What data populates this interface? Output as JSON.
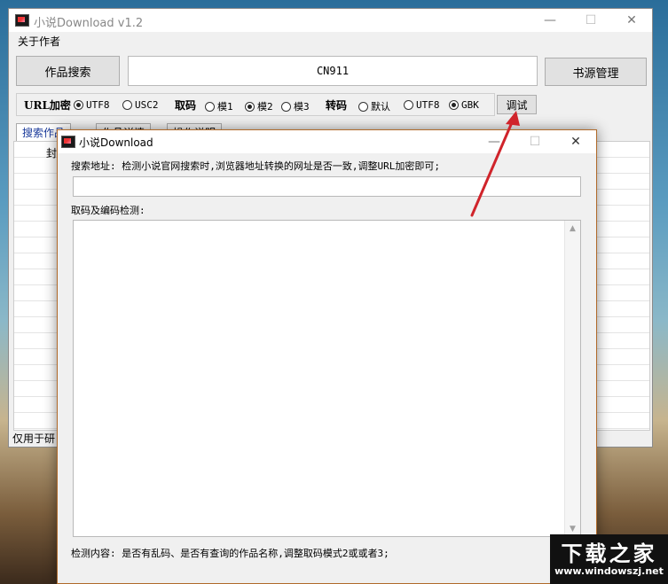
{
  "main_window": {
    "title": "小说Download v1.2",
    "controls": {
      "minimize": "—",
      "maximize": "☐",
      "close": "✕"
    },
    "menu": {
      "about": "关于作者"
    },
    "search_button": "作品搜索",
    "search_value": "CN911",
    "source_button": "书源管理",
    "url_encrypt_label": "URL加密",
    "url_encrypt_options": [
      {
        "label": "UTF8",
        "selected": true
      },
      {
        "label": "USC2",
        "selected": false
      }
    ],
    "fetch_label": "取码",
    "fetch_options": [
      {
        "label": "模1",
        "selected": false
      },
      {
        "label": "模2",
        "selected": true
      },
      {
        "label": "模3",
        "selected": false
      }
    ],
    "convert_label": "转码",
    "convert_options": [
      {
        "label": "默认",
        "selected": false
      },
      {
        "label": "UTF8",
        "selected": false
      },
      {
        "label": "GBK",
        "selected": true
      }
    ],
    "debug_button": "调试",
    "tabs": [
      "搜索作品",
      "作品详情",
      "操作说明"
    ],
    "partial_cell": "封",
    "status_text": "仅用于研"
  },
  "dialog": {
    "title": "小说Download",
    "controls": {
      "minimize": "—",
      "maximize": "☐",
      "close": "✕"
    },
    "search_url_label": "搜索地址: 检测小说官网搜索时,浏览器地址转换的网址是否一致,调整URL加密即可;",
    "search_url_value": "",
    "detect_label": "取码及编码检测:",
    "detect_value": "",
    "footer_text": "检测内容: 是否有乱码、是否有查询的作品名称,调整取码模式2或或者3;"
  },
  "annotation": {
    "color": "#d0242b"
  },
  "watermark": {
    "title": "下载之家",
    "url": "www.windowszj.net"
  }
}
